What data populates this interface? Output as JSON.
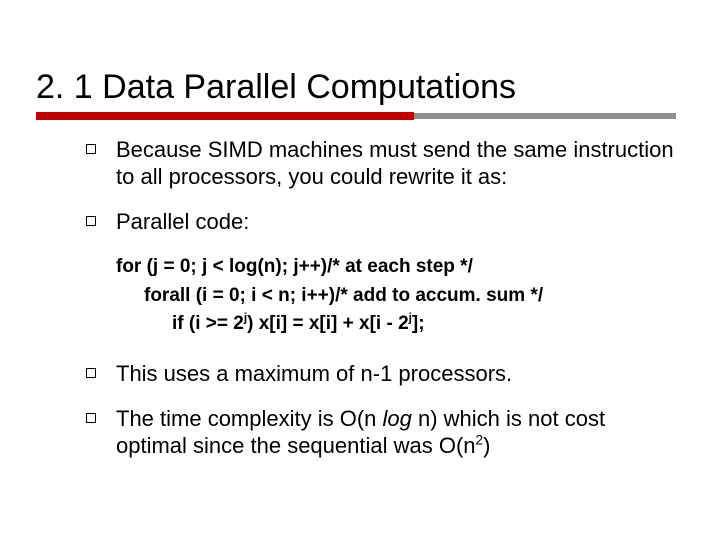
{
  "title": "2. 1 Data Parallel Computations",
  "bullets": {
    "b1": "Because SIMD machines must send the same instruction to all processors, you could rewrite it as:",
    "b2": "Parallel code:",
    "b3": "This uses a maximum of n-1 processors.",
    "b4_pre": "The time complexity is O(n ",
    "b4_log": "log",
    "b4_mid": " n) which is not cost optimal since the sequential was O(n",
    "b4_sup": "2",
    "b4_post": ")"
  },
  "code": {
    "l1": "for (j = 0; j < log(n); j++)/* at each step */",
    "l2": "forall (i = 0; i < n; i++)/* add to accum. sum */",
    "l3_pre": "if (i >= 2",
    "l3_sup1": "j",
    "l3_mid": ") x[i] = x[i] + x[i - 2",
    "l3_sup2": "j",
    "l3_post": "];"
  }
}
